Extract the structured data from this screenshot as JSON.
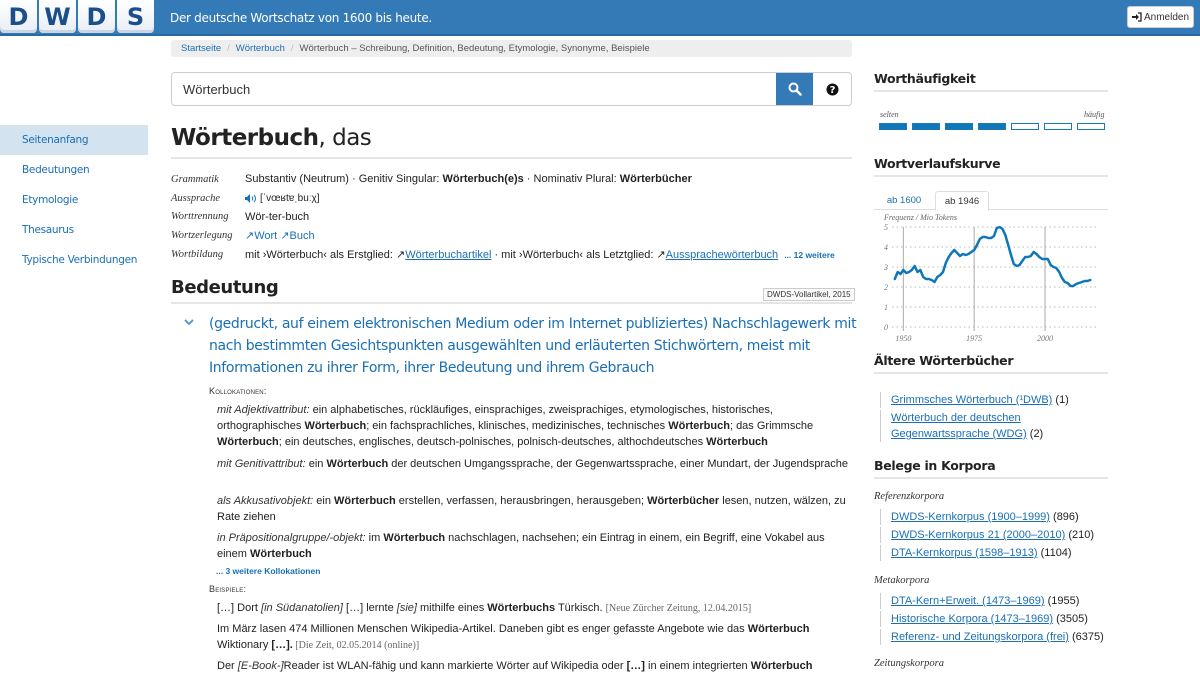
{
  "header": {
    "logo_letters": [
      "D",
      "W",
      "D",
      "S"
    ],
    "tagline": "Der deutsche Wortschatz von 1600 bis heute.",
    "login_label": "Anmelden",
    "login_icon": "sign-in-icon"
  },
  "breadcrumb": {
    "items": [
      "Startseite",
      "Wörterbuch"
    ],
    "current": "Wörterbuch – Schreibung, Definition, Bedeutung, Etymologie, Synonyme, Beispiele"
  },
  "search": {
    "value": "Wörterbuch",
    "search_icon": "search-icon",
    "help_icon": "question-circle-icon"
  },
  "sidenav": {
    "items": [
      {
        "label": "Seitenanfang",
        "active": true
      },
      {
        "label": "Bedeutungen"
      },
      {
        "label": "Etymologie"
      },
      {
        "label": "Thesaurus"
      },
      {
        "label": "Typische Verbindungen"
      }
    ]
  },
  "entry": {
    "lemma": "Wörterbuch",
    "article": ", das",
    "props": {
      "grammatik_label": "Grammatik",
      "grammatik_pre": "Substantiv (Neutrum) · Genitiv Singular: ",
      "genitiv": "Wörterbuch(e)s",
      "grammatik_mid": " · Nominativ Plural: ",
      "plural": "Wörterbücher",
      "aussprache_label": "Aussprache",
      "aussprache": "[ˈvœʁtɐˌbuːχ]",
      "worttrennung_label": "Worttrennung",
      "worttrennung": "Wör-ter-buch",
      "wortzerlegung_label": "Wortzerlegung",
      "wortzerlegung": [
        "↗Wort",
        "↗Buch"
      ],
      "wortbildung_label": "Wortbildung",
      "wortbildung_pre1": "mit ›Wörterbuch‹ als Erstglied: ↗",
      "wortbildung_link1": "Wörterbuchartikel",
      "wortbildung_pre2": " · mit ›Wörterbuch‹ als Letztglied: ↗",
      "wortbildung_link2": "Aussprachewörterbuch",
      "wortbildung_more": "... 12 weitere"
    },
    "bedeutung_title": "Bedeutung",
    "source_badge": "DWDS-Vollartikel, 2015",
    "definition": "(gedruckt, auf einem elektronischen Medium oder im Internet publiziertes) Nachschlagewerk mit nach bestimmten Gesichtspunkten ausgewählten und erläuterten Stichwörtern, meist mit Informationen zu ihrer Form, ihrer Bedeutung und ihrem Gebrauch",
    "kollokationen_label": "Kollokationen:",
    "kollokationen": [
      {
        "label": "mit Adjektivattribut:",
        "text1": " ein alphabetisches, rückläufiges, einsprachiges, zweisprachiges, etymologisches, historisches, orthographisches ",
        "b1": "Wörterbuch",
        "text2": "; ein fachsprachliches, klinisches, medizinisches, technisches ",
        "b2": "Wörterbuch",
        "text3": "; das Grimmsche ",
        "b3": "Wörterbuch",
        "text4": "; ein deutsches, englisches, deutsch-polnisches, polnisch-deutsches, althochdeutsches ",
        "b4": "Wörterbuch"
      },
      {
        "label": "mit Genitivattribut:",
        "text1": " ein ",
        "b1": "Wörterbuch",
        "text2": " der deutschen Umgangssprache, der Gegenwartssprache, einer Mundart, der Jugendsprache"
      },
      {
        "label": "als Akkusativobjekt:",
        "text1": " ein ",
        "b1": "Wörterbuch",
        "text2": " erstellen, verfassen, herausbringen, herausgeben; ",
        "b2": "Wörterbücher",
        "text3": " lesen, nutzen, wälzen, zu Rate ziehen"
      },
      {
        "label": "in Präpositionalgruppe/-objekt:",
        "text1": " im ",
        "b1": "Wörterbuch",
        "text2": " nachschlagen, nachsehen; ein Eintrag in einem, ein Begriff, eine Vokabel aus einem ",
        "b2": "Wörterbuch"
      }
    ],
    "kollokationen_more": "... 3 weitere Kollokationen",
    "beispiele_label": "Beispiele:",
    "beispiele": [
      {
        "t1": "[…] Dort ",
        "i1": "[in Südanatolien]",
        "t2": " […] lernte ",
        "i2": "[sie]",
        "t3": " mithilfe eines ",
        "b1": "Wörterbuchs",
        "t4": " Türkisch. ",
        "cite": "[Neue Zürcher Zeitung, 12.04.2015]"
      },
      {
        "t1": "Im März lasen 474 Millionen Menschen Wikipedia-Artikel. Daneben gibt es enger gefasste Angebote wie das ",
        "b1": "Wörterbuch",
        "t2": " Wiktionary ",
        "b2": "[…].",
        "cite": " [Die Zeit, 02.05.2014 (online)]"
      },
      {
        "t1": "Der ",
        "i1": "[E-Book-]",
        "t2": "Reader ist WLAN-fähig und kann markierte Wörter auf Wikipedia oder ",
        "b0": "[…]",
        "t3": " in einem integrierten ",
        "b1": "Wörterbuch"
      }
    ]
  },
  "sidebar": {
    "worthaeufigkeit_title": "Worthäufigkeit",
    "freq_low": "selten",
    "freq_high": "häufig",
    "freq_level": 4,
    "freq_max": 7,
    "verlauf_title": "Wortverlaufskurve",
    "tabs": [
      {
        "label": "ab 1600"
      },
      {
        "label": "ab 1946",
        "active": true
      }
    ],
    "aeltere_title": "Ältere Wörterbücher",
    "aeltere": [
      {
        "link": "Grimmsches Wörterbuch (¹DWB)",
        "count": "(1)"
      },
      {
        "link": "Wörterbuch der deutschen Gegenwartssprache (WDG)",
        "count": "(2)"
      }
    ],
    "belege_title": "Belege in Korpora",
    "referenz_label": "Referenzkorpora",
    "referenz": [
      {
        "link": "DWDS-Kernkorpus (1900–1999)",
        "count": "(896)"
      },
      {
        "link": "DWDS-Kernkorpus 21 (2000–2010)",
        "count": "(210)"
      },
      {
        "link": "DTA-Kernkorpus (1598–1913)",
        "count": "(1104)"
      }
    ],
    "meta_label": "Metakorpora",
    "meta": [
      {
        "link": "DTA-Kern+Erweit. (1473–1969)",
        "count": "(1955)"
      },
      {
        "link": "Historische Korpora (1473–1969)",
        "count": "(3505)"
      },
      {
        "link": "Referenz- und Zeitungskorpora (frei)",
        "count": "(6375)"
      }
    ],
    "zeitung_label": "Zeitungskorpora"
  },
  "chart_data": {
    "type": "line",
    "title": "Wortverlaufskurve",
    "ylabel": "Frequenz / Mio Tokens",
    "xlabel": "",
    "xlim": [
      1946,
      2018
    ],
    "ylim": [
      0,
      5
    ],
    "xticks": [
      1950,
      1975,
      2000
    ],
    "yticks": [
      0,
      1,
      2,
      3,
      4,
      5
    ],
    "grid": true,
    "color": "#0f76b8",
    "series": [
      {
        "name": "Wörterbuch",
        "x": [
          1947,
          1948,
          1949,
          1950,
          1951,
          1952,
          1953,
          1954,
          1955,
          1956,
          1957,
          1958,
          1959,
          1960,
          1961,
          1962,
          1963,
          1964,
          1965,
          1966,
          1967,
          1968,
          1969,
          1970,
          1971,
          1972,
          1973,
          1974,
          1975,
          1976,
          1977,
          1978,
          1979,
          1980,
          1981,
          1982,
          1983,
          1984,
          1985,
          1986,
          1987,
          1988,
          1989,
          1990,
          1991,
          1992,
          1993,
          1994,
          1995,
          1996,
          1997,
          1998,
          1999,
          2000,
          2001,
          2002,
          2003,
          2004,
          2005,
          2006,
          2007,
          2008,
          2009,
          2010,
          2011,
          2012,
          2013,
          2014,
          2015,
          2016
        ],
        "values": [
          2.4,
          2.75,
          2.65,
          2.85,
          2.7,
          2.75,
          2.85,
          3.05,
          2.75,
          2.85,
          2.5,
          2.4,
          2.4,
          2.35,
          2.25,
          2.5,
          2.6,
          2.75,
          3.2,
          3.5,
          3.7,
          3.85,
          3.7,
          3.55,
          3.65,
          3.6,
          3.65,
          3.75,
          3.85,
          4.1,
          4.4,
          4.5,
          4.5,
          4.45,
          4.45,
          4.55,
          4.95,
          5.0,
          4.9,
          4.6,
          4.1,
          3.6,
          3.15,
          3.05,
          3.1,
          3.3,
          3.5,
          3.5,
          3.55,
          3.75,
          3.65,
          3.5,
          3.4,
          3.4,
          3.4,
          3.1,
          3.0,
          2.95,
          2.75,
          2.45,
          2.25,
          2.2,
          2.05,
          2.05,
          2.15,
          2.2,
          2.25,
          2.3,
          2.3,
          2.35
        ]
      }
    ]
  }
}
